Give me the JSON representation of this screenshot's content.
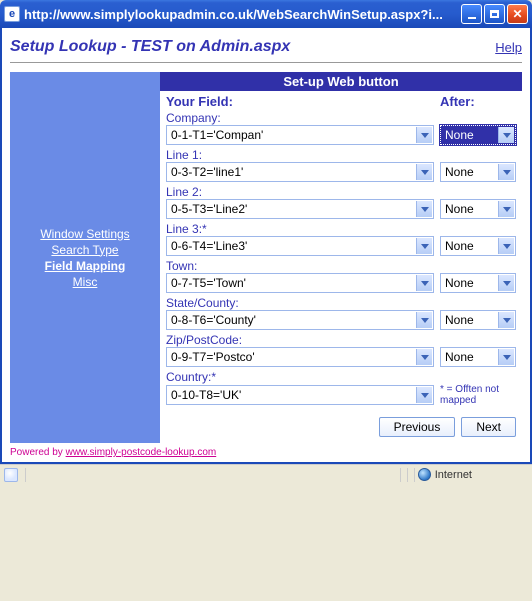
{
  "window": {
    "title": "http://www.simplylookupadmin.co.uk/WebSearchWinSetup.aspx?i..."
  },
  "page": {
    "title": "Setup Lookup - TEST on Admin.aspx",
    "help": "Help"
  },
  "sidebar": {
    "items": [
      {
        "label": "Window Settings",
        "active": false
      },
      {
        "label": "Search Type",
        "active": false
      },
      {
        "label": "Field Mapping",
        "active": true
      },
      {
        "label": "Misc",
        "active": false
      }
    ]
  },
  "panel": {
    "title": "Set-up Web button",
    "your_field": "Your Field:",
    "after": "After:",
    "note": "* = Offten not mapped",
    "fields": [
      {
        "label": "Company:",
        "value": "0-1-T1='Compan'",
        "after": "None",
        "selected": true,
        "hasAfter": true
      },
      {
        "label": "Line 1:",
        "value": "0-3-T2='line1'",
        "after": "None",
        "selected": false,
        "hasAfter": true
      },
      {
        "label": "Line 2:",
        "value": "0-5-T3='Line2'",
        "after": "None",
        "selected": false,
        "hasAfter": true
      },
      {
        "label": "Line 3:*",
        "value": "0-6-T4='Line3'",
        "after": "None",
        "selected": false,
        "hasAfter": true
      },
      {
        "label": "Town:",
        "value": "0-7-T5='Town'",
        "after": "None",
        "selected": false,
        "hasAfter": true
      },
      {
        "label": "State/County:",
        "value": "0-8-T6='County'",
        "after": "None",
        "selected": false,
        "hasAfter": true
      },
      {
        "label": "Zip/PostCode:",
        "value": "0-9-T7='Postco'",
        "after": "None",
        "selected": false,
        "hasAfter": true
      },
      {
        "label": "Country:*",
        "value": "0-10-T8='UK'",
        "after": "",
        "selected": false,
        "hasAfter": false
      }
    ],
    "buttons": {
      "prev": "Previous",
      "next": "Next"
    }
  },
  "footer": {
    "powered_prefix": "Powered by ",
    "powered_link": "www.simply-postcode-lookup.com"
  },
  "status": {
    "zone": "Internet"
  }
}
